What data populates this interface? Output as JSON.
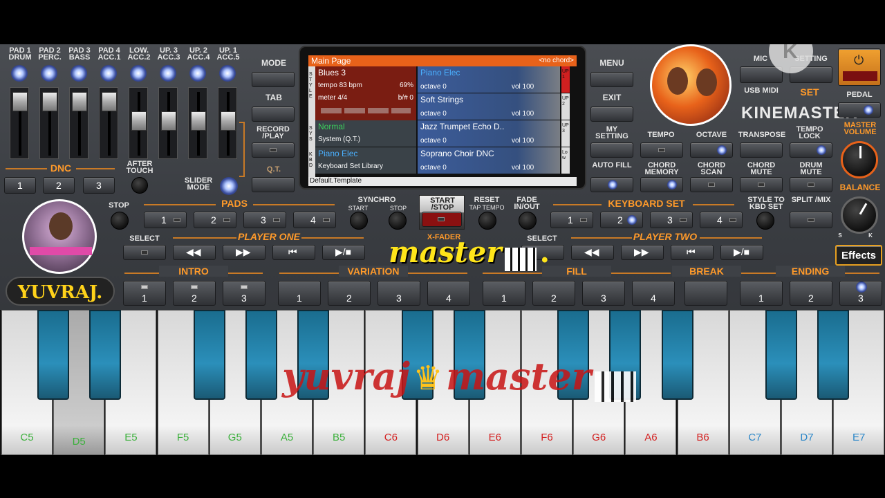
{
  "pads": [
    {
      "line1": "PAD 1",
      "line2": "DRUM"
    },
    {
      "line1": "PAD 2",
      "line2": "PERC."
    },
    {
      "line1": "PAD 3",
      "line2": "BASS"
    },
    {
      "line1": "PAD 4",
      "line2": "ACC.1"
    },
    {
      "line1": "LOW.",
      "line2": "ACC.2"
    },
    {
      "line1": "UP. 3",
      "line2": "ACC.3"
    },
    {
      "line1": "UP. 2",
      "line2": "ACC.4"
    },
    {
      "line1": "UP. 1",
      "line2": "ACC.5"
    }
  ],
  "dnc": {
    "title": "DNC",
    "buttons": [
      "1",
      "2",
      "3"
    ],
    "after_touch": "AFTER TOUCH",
    "slider_mode": "SLIDER MODE"
  },
  "left_menu": {
    "mode": "MODE",
    "tab": "TAB",
    "record": "RECORD /PLAY",
    "qt": "Q.T."
  },
  "right_menu": {
    "menu": "MENU",
    "exit": "EXIT",
    "my_setting": "MY SETTING",
    "auto_fill": "AUTO FILL"
  },
  "screen": {
    "header": "Main Page",
    "chord": "<no chord>",
    "style_name": "Blues 3",
    "tempo": "tempo 83 bpm",
    "percent": "69%",
    "meter": "meter 4/4",
    "bsharp": "b/# 0",
    "sys_name": "Normal",
    "sys_sub": "System (Q.T.)",
    "kbd_name": "Piano Elec",
    "kbd_sub": "Keyboard Set Library",
    "footer": "Default.Template",
    "side_left_1": "STYLE",
    "side_left_2": "SYS",
    "side_left_3": "KBD",
    "parts": [
      {
        "name": "Piano Elec",
        "octave": "octave 0",
        "vol": "vol 100",
        "tag": "UP1"
      },
      {
        "name": "Soft Strings",
        "octave": "octave 0",
        "vol": "vol 100",
        "tag": "UP2"
      },
      {
        "name": "Jazz Trumpet Echo D..",
        "octave": "octave 0",
        "vol": "vol 100",
        "tag": "UP3"
      },
      {
        "name": "Soprano Choir DNC",
        "octave": "octave 0",
        "vol": "vol 100",
        "tag": "Low"
      }
    ]
  },
  "right_panel": {
    "mic": "MIC",
    "setting": "SETTING",
    "usb_midi": "USB MIDI",
    "set": "SET",
    "pedal": "PEDAL",
    "watermark": "KINEMASTER",
    "tempo": "TEMPO",
    "octave": "OCTAVE",
    "transpose": "TRANSPOSE",
    "tempo_lock": "TEMPO LOCK",
    "master_volume": "MASTER VOLUME",
    "chord_memory": "CHORD MEMORY",
    "chord_scan": "CHORD SCAN",
    "chord_mute": "CHORD MUTE",
    "drum_mute": "DRUM MUTE",
    "balance": "BALANCE",
    "balance_s": "S",
    "balance_k": "K",
    "effects": "Effects"
  },
  "row2": {
    "stop": "STOP",
    "pads": "PADS",
    "pad_buttons": [
      "1",
      "2",
      "3",
      "4"
    ],
    "synchro": "SYNCHRO",
    "synchro_start": "START",
    "synchro_stop": "STOP",
    "start_stop": "START /STOP",
    "reset": "RESET",
    "tap_tempo": "TAP TEMPO",
    "fade": "FADE IN/OUT",
    "keyboard_set": "KEYBOARD SET",
    "kbd_buttons": [
      "1",
      "2",
      "3",
      "4"
    ],
    "style_to_kbd": "STYLE TO KBD SET",
    "split": "SPLIT /MIX"
  },
  "row3": {
    "select": "SELECT",
    "player_one": "PLAYER ONE",
    "x_fader": "X-FADER",
    "select2": "SELECT",
    "player_two": "PLAYER TWO"
  },
  "row4": {
    "intro": "INTRO",
    "intro_buttons": [
      "1",
      "2",
      "3"
    ],
    "variation": "VARIATION",
    "variation_buttons": [
      "1",
      "2",
      "3",
      "4"
    ],
    "fill": "FILL",
    "fill_buttons": [
      "1",
      "2",
      "3",
      "4"
    ],
    "break": "BREAK",
    "ending": "ENDING",
    "ending_buttons": [
      "1",
      "2",
      "3"
    ]
  },
  "overlay": {
    "yuvraj_badge": "YUVRAJ.",
    "master_text": "master",
    "master_dot": ".",
    "bottom_text_left": "yuvraj",
    "bottom_text_right": "master"
  },
  "keys": [
    {
      "label": "C5",
      "color": "#3bb03b"
    },
    {
      "label": "D5",
      "color": "#3bb03b"
    },
    {
      "label": "E5",
      "color": "#3bb03b"
    },
    {
      "label": "F5",
      "color": "#3bb03b"
    },
    {
      "label": "G5",
      "color": "#3bb03b"
    },
    {
      "label": "A5",
      "color": "#3bb03b"
    },
    {
      "label": "B5",
      "color": "#3bb03b"
    },
    {
      "label": "C6",
      "color": "#d42020"
    },
    {
      "label": "D6",
      "color": "#d42020"
    },
    {
      "label": "E6",
      "color": "#d42020"
    },
    {
      "label": "F6",
      "color": "#d42020"
    },
    {
      "label": "G6",
      "color": "#d42020"
    },
    {
      "label": "A6",
      "color": "#d42020"
    },
    {
      "label": "B6",
      "color": "#d42020"
    },
    {
      "label": "C7",
      "color": "#2a86c8"
    },
    {
      "label": "D7",
      "color": "#2a86c8"
    },
    {
      "label": "E7",
      "color": "#2a86c8"
    }
  ],
  "colors": {
    "accent": "#ff9a2a",
    "screen_header": "#e8621a",
    "led": "#c8d6ff",
    "start_stop": "#8a1010"
  }
}
